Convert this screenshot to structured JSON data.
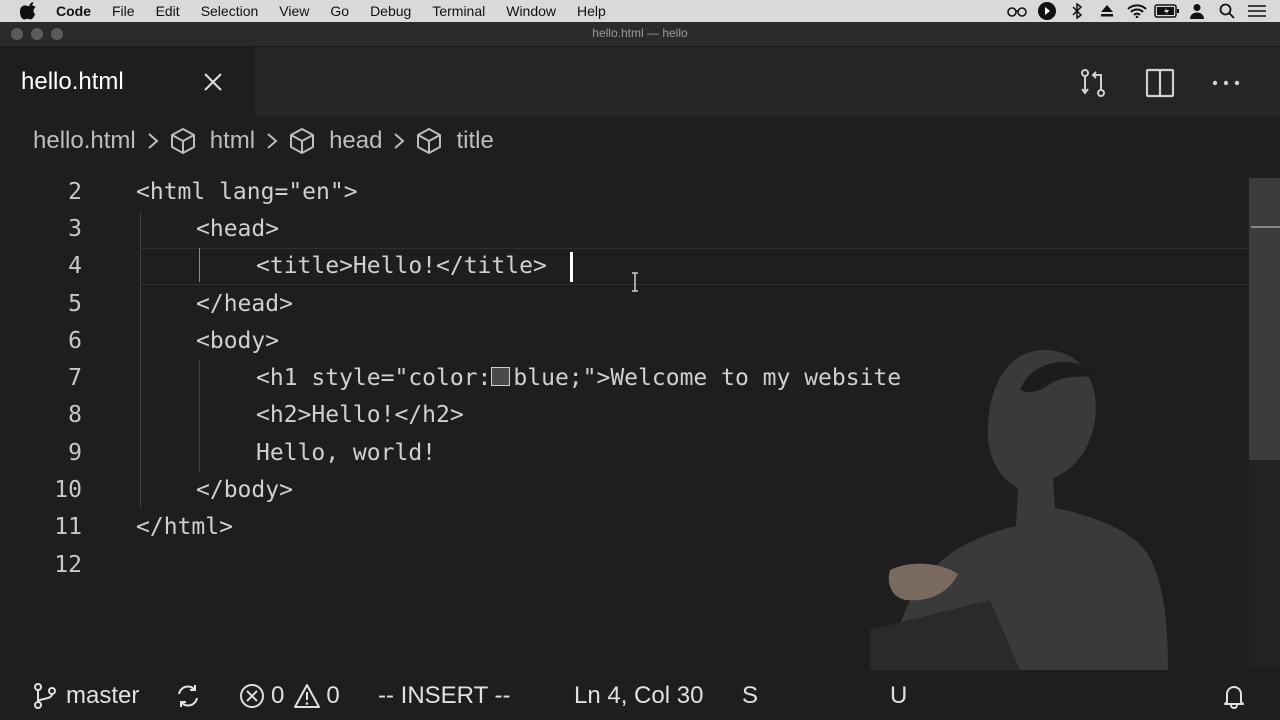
{
  "menubar": {
    "app_name": "Code",
    "items": [
      "File",
      "Edit",
      "Selection",
      "View",
      "Go",
      "Debug",
      "Terminal",
      "Window",
      "Help"
    ],
    "status_icons": [
      "glasses-icon",
      "play-circle-icon",
      "bluetooth-icon",
      "eject-icon",
      "wifi-icon",
      "battery-icon",
      "user-icon",
      "search-icon",
      "list-icon"
    ]
  },
  "window": {
    "title": "hello.html — hello"
  },
  "tab": {
    "label": "hello.html"
  },
  "breadcrumb": {
    "file": "hello.html",
    "items": [
      "html",
      "head",
      "title"
    ]
  },
  "editor": {
    "lines": [
      {
        "num": "2",
        "text": "<html lang=\"en\">"
      },
      {
        "num": "3",
        "text": "<head>"
      },
      {
        "num": "4",
        "text": "<title>Hello!</title>"
      },
      {
        "num": "5",
        "text": "</head>"
      },
      {
        "num": "6",
        "text": "<body>"
      },
      {
        "num": "7",
        "text_before": "<h1 style=\"color:",
        "text_after": "blue;\">Welcome to my website"
      },
      {
        "num": "8",
        "text": "<h2>Hello!</h2>"
      },
      {
        "num": "9",
        "text": "Hello, world!"
      },
      {
        "num": "10",
        "text": "</body>"
      },
      {
        "num": "11",
        "text": "</html>"
      },
      {
        "num": "12",
        "text": ""
      }
    ]
  },
  "statusbar": {
    "branch": "master",
    "errors": "0",
    "warnings": "0",
    "mode": "-- INSERT --",
    "position": "Ln 4, Col 30",
    "partial_1": "S",
    "partial_2": "U"
  }
}
